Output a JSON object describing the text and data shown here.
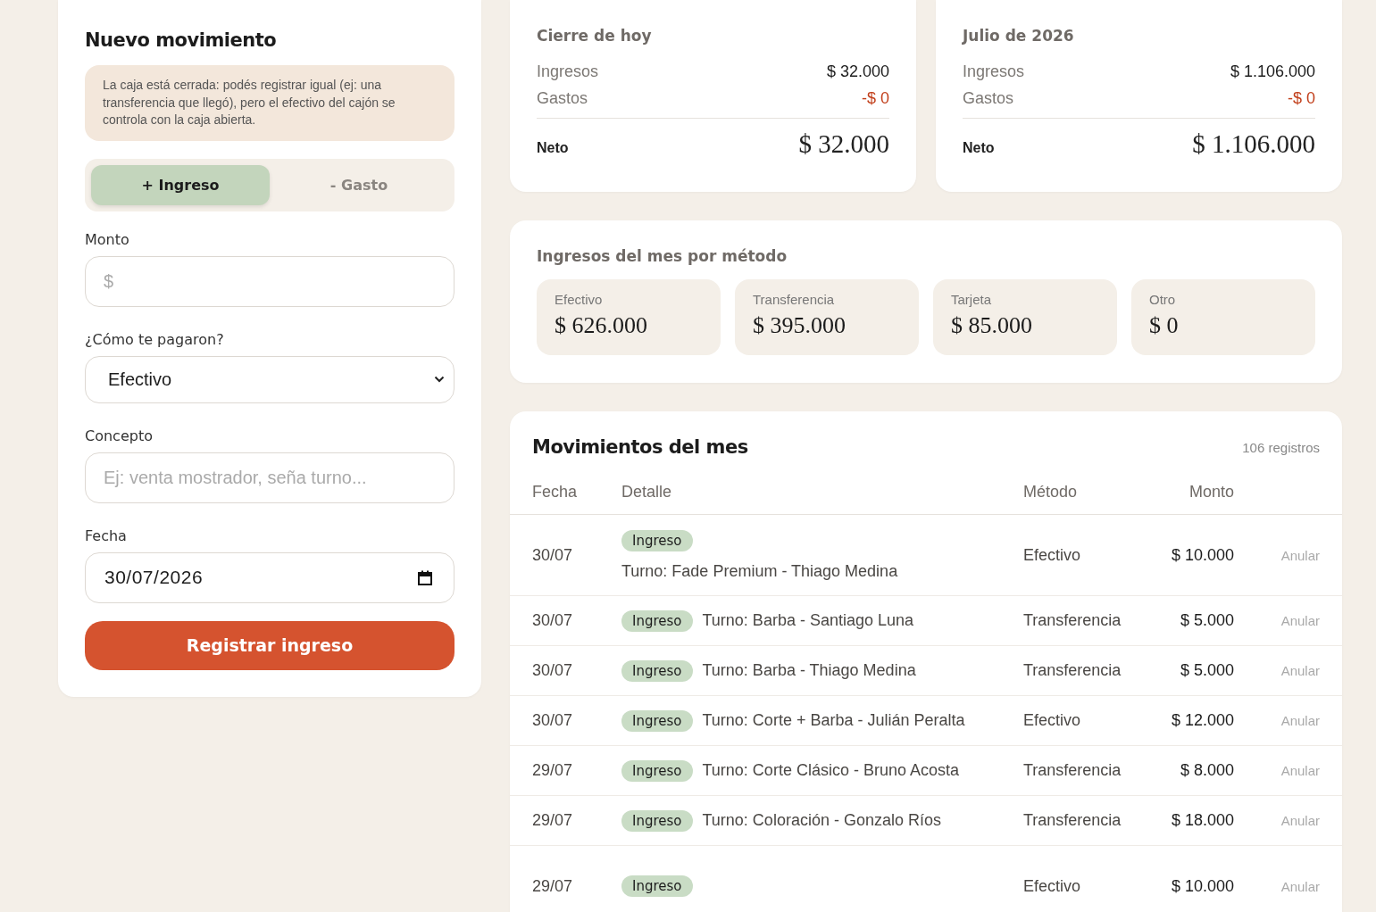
{
  "form": {
    "title": "Nuevo movimiento",
    "notice": "La caja está cerrada: podés registrar igual (ej: una transferencia que llegó), pero el efectivo del cajón se controla con la caja abierta.",
    "types": [
      {
        "label": "+ Ingreso",
        "selected": true
      },
      {
        "label": "- Gasto",
        "selected": false
      }
    ],
    "amount": {
      "label": "Monto",
      "placeholder": "$"
    },
    "method": {
      "label": "¿Cómo te pagaron?",
      "value": "Efectivo"
    },
    "concept": {
      "label": "Concepto",
      "placeholder": "Ej: venta mostrador, seña turno..."
    },
    "date": {
      "label": "Fecha",
      "value": "30/07/2026"
    },
    "submit": "Registrar ingreso"
  },
  "summaries": [
    {
      "title": "Cierre de hoy",
      "income_label": "Ingresos",
      "income": "$ 32.000",
      "expense_label": "Gastos",
      "expense": "-$ 0",
      "net_label": "Neto",
      "net": "$ 32.000"
    },
    {
      "title": "Julio de 2026",
      "income_label": "Ingresos",
      "income": "$ 1.106.000",
      "expense_label": "Gastos",
      "expense": "-$ 0",
      "net_label": "Neto",
      "net": "$ 1.106.000"
    }
  ],
  "methods": {
    "title": "Ingresos del mes por método",
    "items": [
      {
        "label": "Efectivo",
        "amount": "$ 626.000"
      },
      {
        "label": "Transferencia",
        "amount": "$ 395.000"
      },
      {
        "label": "Tarjeta",
        "amount": "$ 85.000"
      },
      {
        "label": "Otro",
        "amount": "$ 0"
      }
    ]
  },
  "movements": {
    "title": "Movimientos del mes",
    "count": "106 registros",
    "columns": [
      "Fecha",
      "Detalle",
      "Método",
      "Monto"
    ],
    "rows": [
      {
        "kind": "stacked",
        "date": "30/07",
        "tag": "Ingreso",
        "detail": "Turno: Fade Premium - Thiago Medina",
        "method": "Efectivo",
        "amount": "$ 10.000",
        "action": "Anular"
      },
      {
        "kind": "inline",
        "date": "30/07",
        "tag": "Ingreso",
        "detail": "Turno: Barba - Santiago Luna",
        "method": "Transferencia",
        "amount": "$ 5.000",
        "action": "Anular"
      },
      {
        "kind": "inline",
        "date": "30/07",
        "tag": "Ingreso",
        "detail": "Turno: Barba - Thiago Medina",
        "method": "Transferencia",
        "amount": "$ 5.000",
        "action": "Anular"
      },
      {
        "kind": "inline",
        "date": "30/07",
        "tag": "Ingreso",
        "detail": "Turno: Corte + Barba - Julián Peralta",
        "method": "Efectivo",
        "amount": "$ 12.000",
        "action": "Anular"
      },
      {
        "kind": "inline",
        "date": "29/07",
        "tag": "Ingreso",
        "detail": "Turno: Corte Clásico - Bruno Acosta",
        "method": "Transferencia",
        "amount": "$ 8.000",
        "action": "Anular"
      },
      {
        "kind": "inline",
        "date": "29/07",
        "tag": "Ingreso",
        "detail": "Turno: Coloración - Gonzalo Ríos",
        "method": "Transferencia",
        "amount": "$ 18.000",
        "action": "Anular"
      },
      {
        "kind": "stacked",
        "date": "29/07",
        "tag": "Ingreso",
        "method": "Efectivo",
        "amount": "$ 10.000",
        "action": "Anular"
      }
    ]
  }
}
